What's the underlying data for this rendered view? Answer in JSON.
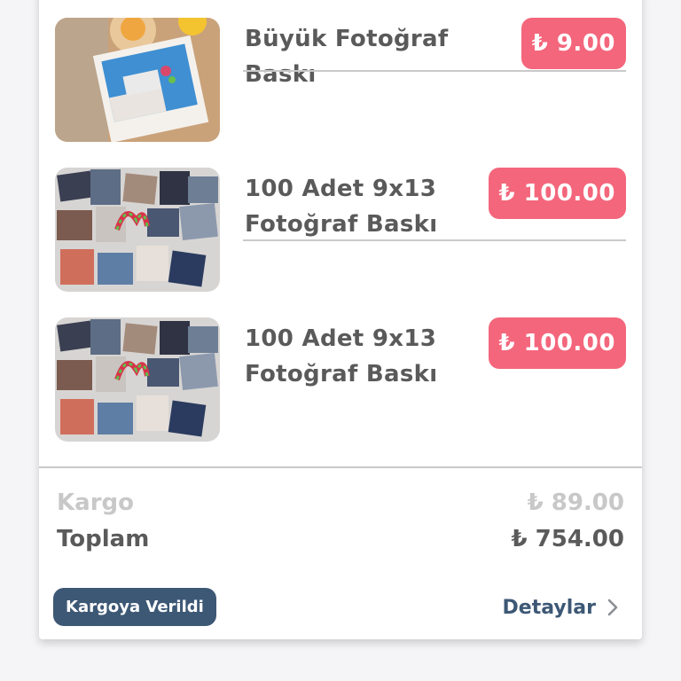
{
  "order": {
    "items": [
      {
        "title": "Büyük Fotoğraf Baskı",
        "price": "₺ 9.00",
        "image": "photo-print-desk-image"
      },
      {
        "title": "100 Adet 9x13 Fotoğraf Baskı",
        "price": "₺ 100.00",
        "image": "photo-collage-image"
      },
      {
        "title": "100 Adet 9x13 Fotoğraf Baskı",
        "price": "₺ 100.00",
        "image": "photo-collage-image"
      }
    ],
    "summary": {
      "shipping_label": "Kargo",
      "shipping_value": "₺ 89.00",
      "total_label": "Toplam",
      "total_value": "₺ 754.00"
    },
    "status": "Kargoya Verildi",
    "details_label": "Detaylar",
    "details_icon": "chevron-right-icon"
  },
  "colors": {
    "price_badge": "#f4667c",
    "status_badge": "#3d5875",
    "text_primary": "#5a5a5a",
    "text_muted": "#c8c8c8",
    "link": "#3d5875"
  }
}
